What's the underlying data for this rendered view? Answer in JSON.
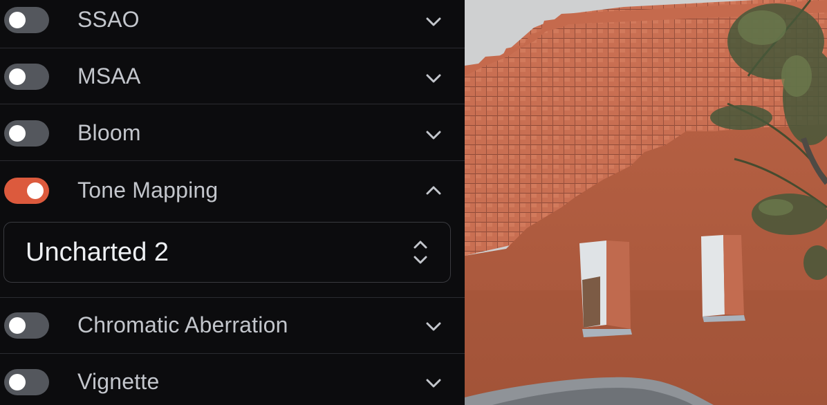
{
  "effects": [
    {
      "label": "SSAO",
      "enabled": false,
      "expanded": false
    },
    {
      "label": "MSAA",
      "enabled": false,
      "expanded": false
    },
    {
      "label": "Bloom",
      "enabled": false,
      "expanded": false
    },
    {
      "label": "Tone Mapping",
      "enabled": true,
      "expanded": true
    },
    {
      "label": "Chromatic Aberration",
      "enabled": false,
      "expanded": false
    },
    {
      "label": "Vignette",
      "enabled": false,
      "expanded": false
    }
  ],
  "tone_mapping": {
    "selected": "Uncharted 2"
  },
  "colors": {
    "panel_bg": "#0c0c0e",
    "toggle_on": "#dc5a3d",
    "toggle_off": "#54575d",
    "divider": "#2b2c31",
    "label": "#c3c6cc"
  },
  "icons": [
    "chevron-down-icon",
    "chevron-up-icon",
    "select-updown-icon"
  ]
}
